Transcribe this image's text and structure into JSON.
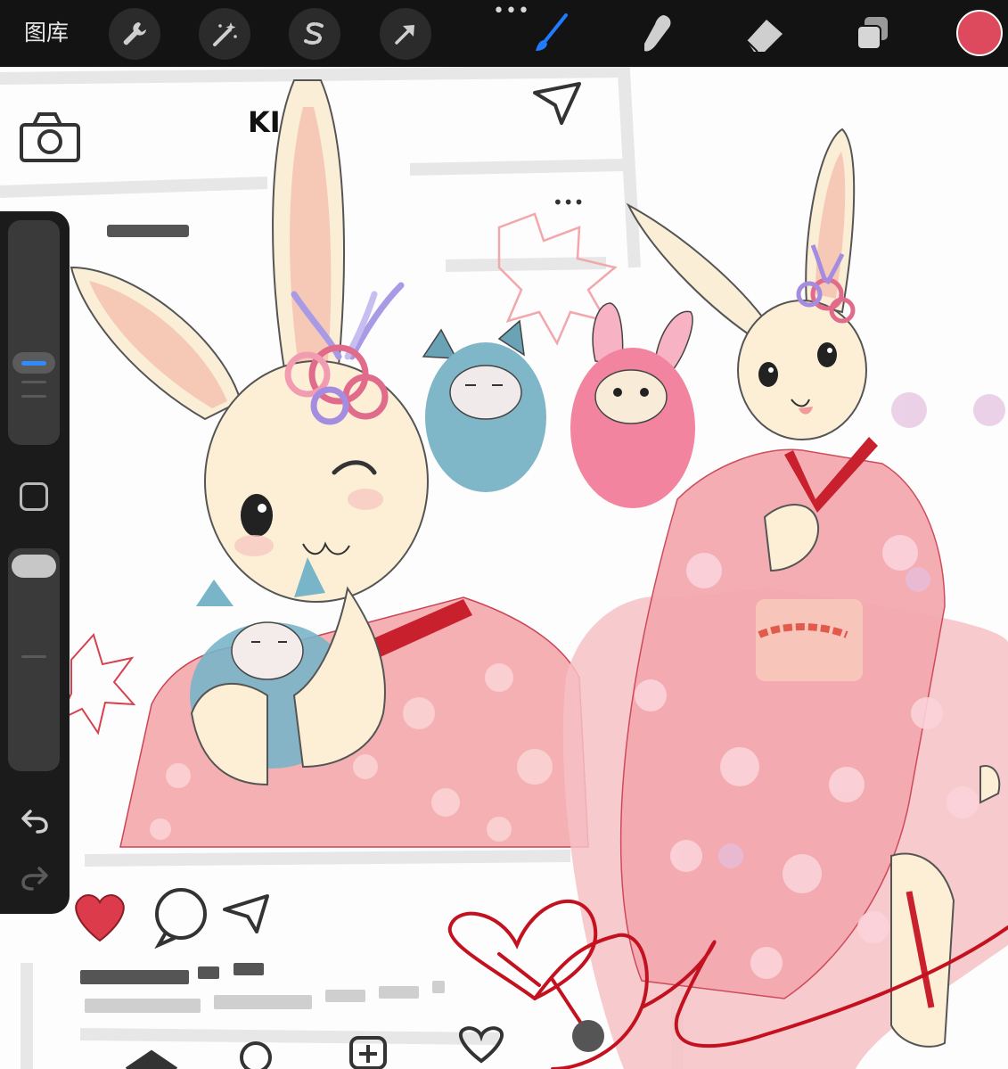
{
  "toolbar": {
    "gallery_label": "图库",
    "more_label": "•••",
    "tools": {
      "actions": "wrench-icon",
      "adjustments": "magic-wand-icon",
      "selection": "selection-s-icon",
      "transform": "arrow-cursor-icon",
      "brush": "brush-icon",
      "smudge": "smudge-finger-icon",
      "eraser": "eraser-icon",
      "layers": "layers-icon"
    },
    "active_tool": "brush",
    "current_color": "#de4a5d",
    "active_color": "#1f7bff"
  },
  "sidebar": {
    "brush_size_level": 0.6,
    "opacity_level": 1.0,
    "undo_icon": "undo-icon",
    "redo_icon": "redo-icon",
    "modify_icon": "square-icon"
  },
  "canvas": {
    "mock_header_text": "KI"
  }
}
